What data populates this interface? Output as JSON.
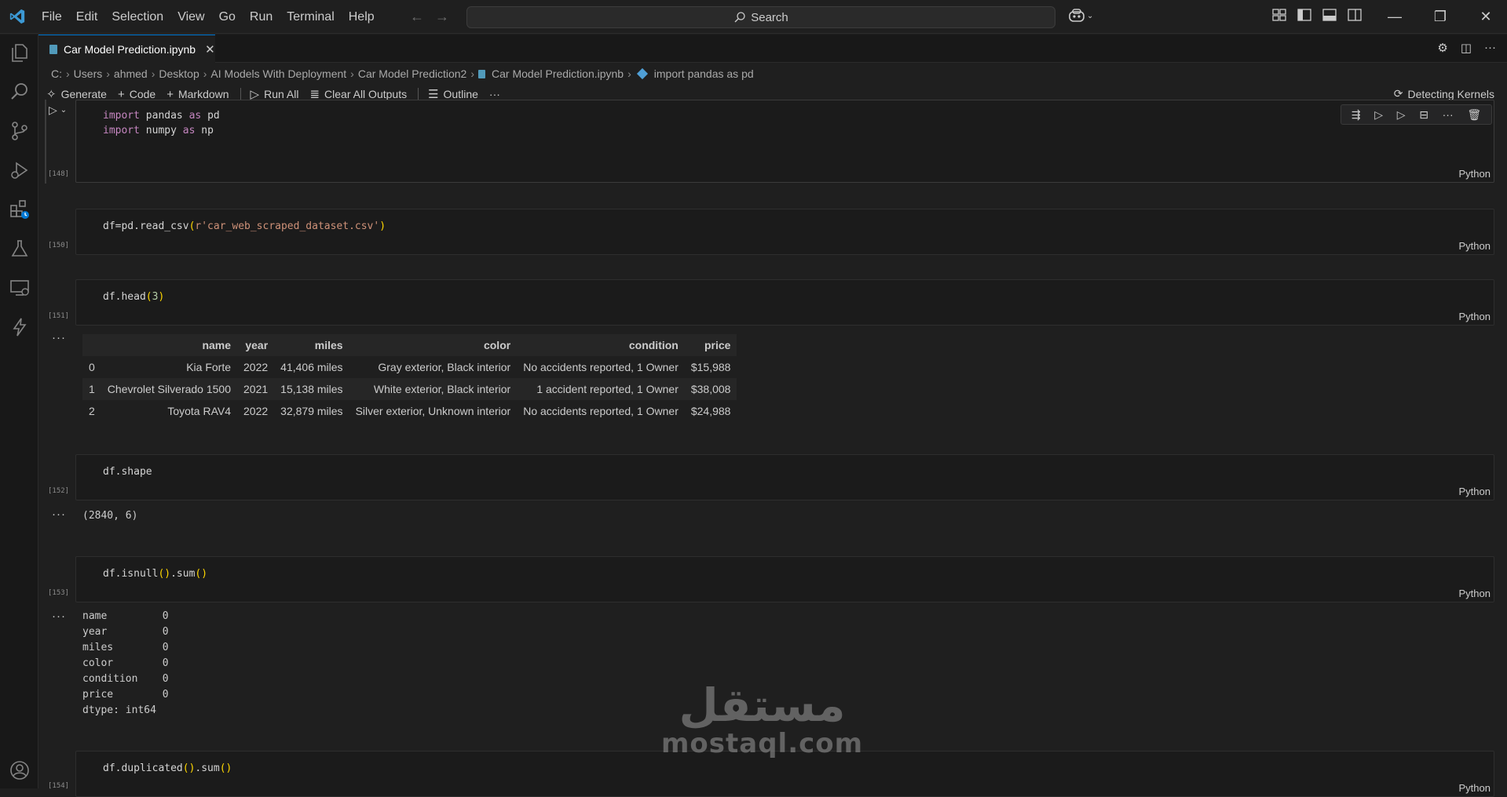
{
  "menu": [
    "File",
    "Edit",
    "Selection",
    "View",
    "Go",
    "Run",
    "Terminal",
    "Help"
  ],
  "search": {
    "label": "Search"
  },
  "tab": {
    "title": "Car Model Prediction.ipynb",
    "close": "✕"
  },
  "breadcrumbs": [
    "C:",
    "Users",
    "ahmed",
    "Desktop",
    "AI Models With Deployment",
    "Car Model Prediction2",
    "Car Model Prediction.ipynb",
    "import pandas as pd"
  ],
  "toolbar": {
    "generate": "Generate",
    "code": "Code",
    "markdown": "Markdown",
    "run_all": "Run All",
    "clear_outputs": "Clear All Outputs",
    "outline": "Outline",
    "more": "···",
    "kernel": "Detecting Kernels"
  },
  "cells": [
    {
      "exec": "[148]",
      "lang": "Python"
    },
    {
      "exec": "[150]",
      "lang": "Python"
    },
    {
      "exec": "[151]",
      "lang": "Python"
    },
    {
      "exec": "[152]",
      "lang": "Python",
      "output": "(2840, 6)"
    },
    {
      "exec": "[153]",
      "lang": "Python"
    },
    {
      "exec": "[154]",
      "lang": "Python"
    }
  ],
  "code": {
    "c1_l1_a": "import",
    "c1_l1_b": " pandas ",
    "c1_l1_c": "as",
    "c1_l1_d": " pd",
    "c1_l2_a": "import",
    "c1_l2_b": " numpy ",
    "c1_l2_c": "as",
    "c1_l2_d": " np",
    "c2_a": "df=pd.read_csv",
    "c2_b": "(",
    "c2_c": "r'car_web_scraped_dataset.csv'",
    "c2_d": ")",
    "c3_a": "df.head",
    "c3_b": "(",
    "c3_c": "3",
    "c3_d": ")",
    "c4": "df.shape",
    "c5_a": "df.isnull",
    "c5_b": "()",
    "c5_c": ".sum",
    "c5_d": "()",
    "c6_a": "df.duplicated",
    "c6_b": "()",
    "c6_c": ".sum",
    "c6_d": "()"
  },
  "dataframe": {
    "columns": [
      "",
      "name",
      "year",
      "miles",
      "color",
      "condition",
      "price"
    ],
    "rows": [
      [
        "0",
        "Kia Forte",
        "2022",
        "41,406 miles",
        "Gray exterior, Black interior",
        "No accidents reported, 1 Owner",
        "$15,988"
      ],
      [
        "1",
        "Chevrolet Silverado 1500",
        "2021",
        "15,138 miles",
        "White exterior, Black interior",
        "1 accident reported, 1 Owner",
        "$38,008"
      ],
      [
        "2",
        "Toyota RAV4",
        "2022",
        "32,879 miles",
        "Silver exterior, Unknown interior",
        "No accidents reported, 1 Owner",
        "$24,988"
      ]
    ]
  },
  "isnull_output": "name         0\nyear         0\nmiles        0\ncolor        0\ncondition    0\nprice        0\ndtype: int64",
  "output_dots": "···",
  "watermark": {
    "arabic": "مستقل",
    "latin": "mostaql.com"
  },
  "colors": {
    "accent": "#0078d4",
    "background": "#1f1f1f",
    "keyword": "#c586c0",
    "string": "#ce9178",
    "bracket": "#ffd700"
  }
}
